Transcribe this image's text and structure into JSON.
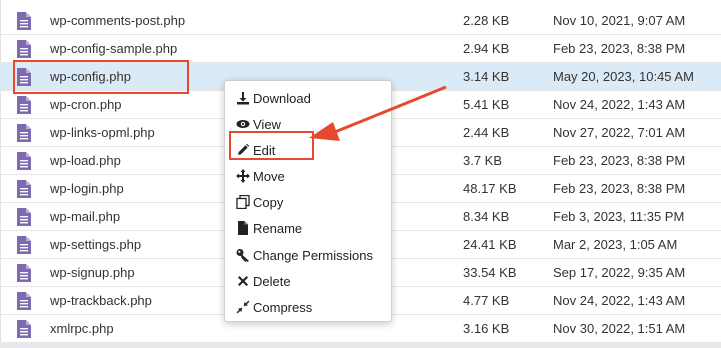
{
  "files": [
    {
      "name": "wp-comments-post.php",
      "size": "2.28 KB",
      "modified": "Nov 10, 2021, 9:07 AM"
    },
    {
      "name": "wp-config-sample.php",
      "size": "2.94 KB",
      "modified": "Feb 23, 2023, 8:38 PM"
    },
    {
      "name": "wp-config.php",
      "size": "3.14 KB",
      "modified": "May 20, 2023, 10:45 AM",
      "selected": true
    },
    {
      "name": "wp-cron.php",
      "size": "5.41 KB",
      "modified": "Nov 24, 2022, 1:43 AM"
    },
    {
      "name": "wp-links-opml.php",
      "size": "2.44 KB",
      "modified": "Nov 27, 2022, 7:01 AM"
    },
    {
      "name": "wp-load.php",
      "size": "3.7 KB",
      "modified": "Feb 23, 2023, 8:38 PM"
    },
    {
      "name": "wp-login.php",
      "size": "48.17 KB",
      "modified": "Feb 23, 2023, 8:38 PM"
    },
    {
      "name": "wp-mail.php",
      "size": "8.34 KB",
      "modified": "Feb 3, 2023, 11:35 PM"
    },
    {
      "name": "wp-settings.php",
      "size": "24.41 KB",
      "modified": "Mar 2, 2023, 1:05 AM"
    },
    {
      "name": "wp-signup.php",
      "size": "33.54 KB",
      "modified": "Sep 17, 2022, 9:35 AM"
    },
    {
      "name": "wp-trackback.php",
      "size": "4.77 KB",
      "modified": "Nov 24, 2022, 1:43 AM"
    },
    {
      "name": "xmlrpc.php",
      "size": "3.16 KB",
      "modified": "Nov 30, 2022, 1:51 AM"
    }
  ],
  "context_menu": [
    {
      "label": "Download",
      "icon": "download-icon"
    },
    {
      "label": "View",
      "icon": "eye-icon"
    },
    {
      "label": "Edit",
      "icon": "pencil-icon"
    },
    {
      "label": "Move",
      "icon": "move-icon"
    },
    {
      "label": "Copy",
      "icon": "copy-icon"
    },
    {
      "label": "Rename",
      "icon": "file-icon"
    },
    {
      "label": "Change Permissions",
      "icon": "key-icon"
    },
    {
      "label": "Delete",
      "icon": "x-icon"
    },
    {
      "label": "Compress",
      "icon": "compress-icon"
    }
  ],
  "colors": {
    "file_icon": "#7d6ab0",
    "selected_row": "#dbeaf7",
    "annotation": "#e64a2e"
  }
}
